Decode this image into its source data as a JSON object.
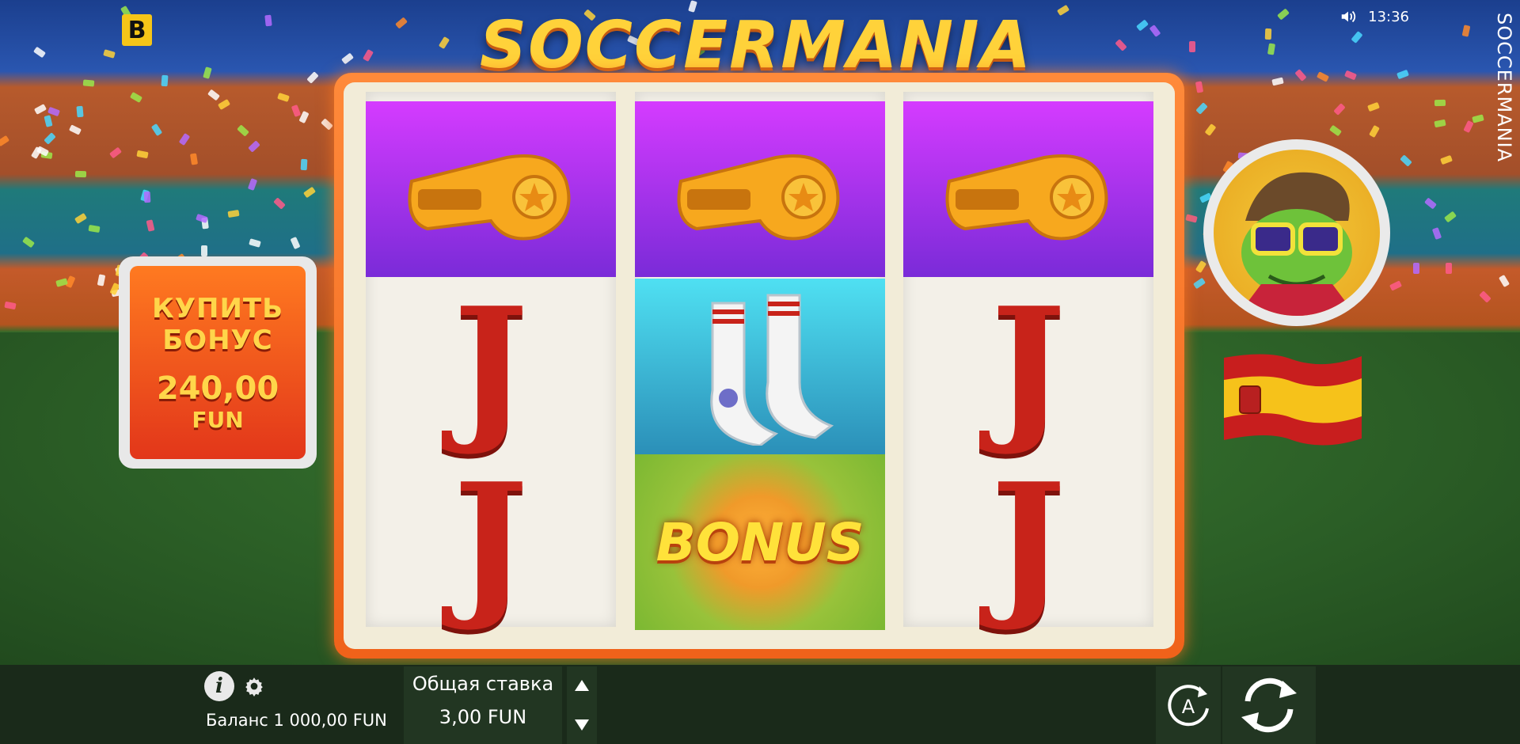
{
  "header": {
    "logo_letter": "B",
    "game_title": "SOCCERMANIA",
    "clock": "13:36",
    "side_title": "SOCCERMANIA"
  },
  "reels": [
    {
      "symbols": [
        {
          "icon": "whistle-icon"
        },
        {
          "icon": "letter-j",
          "text": "J"
        },
        {
          "icon": "letter-j",
          "text": "J"
        }
      ]
    },
    {
      "symbols": [
        {
          "icon": "whistle-icon"
        },
        {
          "icon": "socks-icon"
        },
        {
          "icon": "bonus-ball",
          "text": "BONUS"
        }
      ]
    },
    {
      "symbols": [
        {
          "icon": "whistle-icon"
        },
        {
          "icon": "letter-j",
          "text": "J"
        },
        {
          "icon": "letter-j",
          "text": "J"
        }
      ]
    }
  ],
  "buy_bonus": {
    "line1": "КУПИТЬ",
    "line2": "БОНУС",
    "amount": "240,00",
    "currency": "FUN"
  },
  "team_flag": "spain-flag",
  "bottom": {
    "balance": "Баланс 1 000,00 FUN",
    "stake_label": "Общая ставка",
    "stake_value": "3,00 FUN",
    "info_label": "i"
  },
  "colors": {
    "frame": "#f0621a",
    "accent_yellow": "#ffd23a",
    "reel_purple": "#b234f0",
    "bottom_bar": "#1a2a1a"
  }
}
